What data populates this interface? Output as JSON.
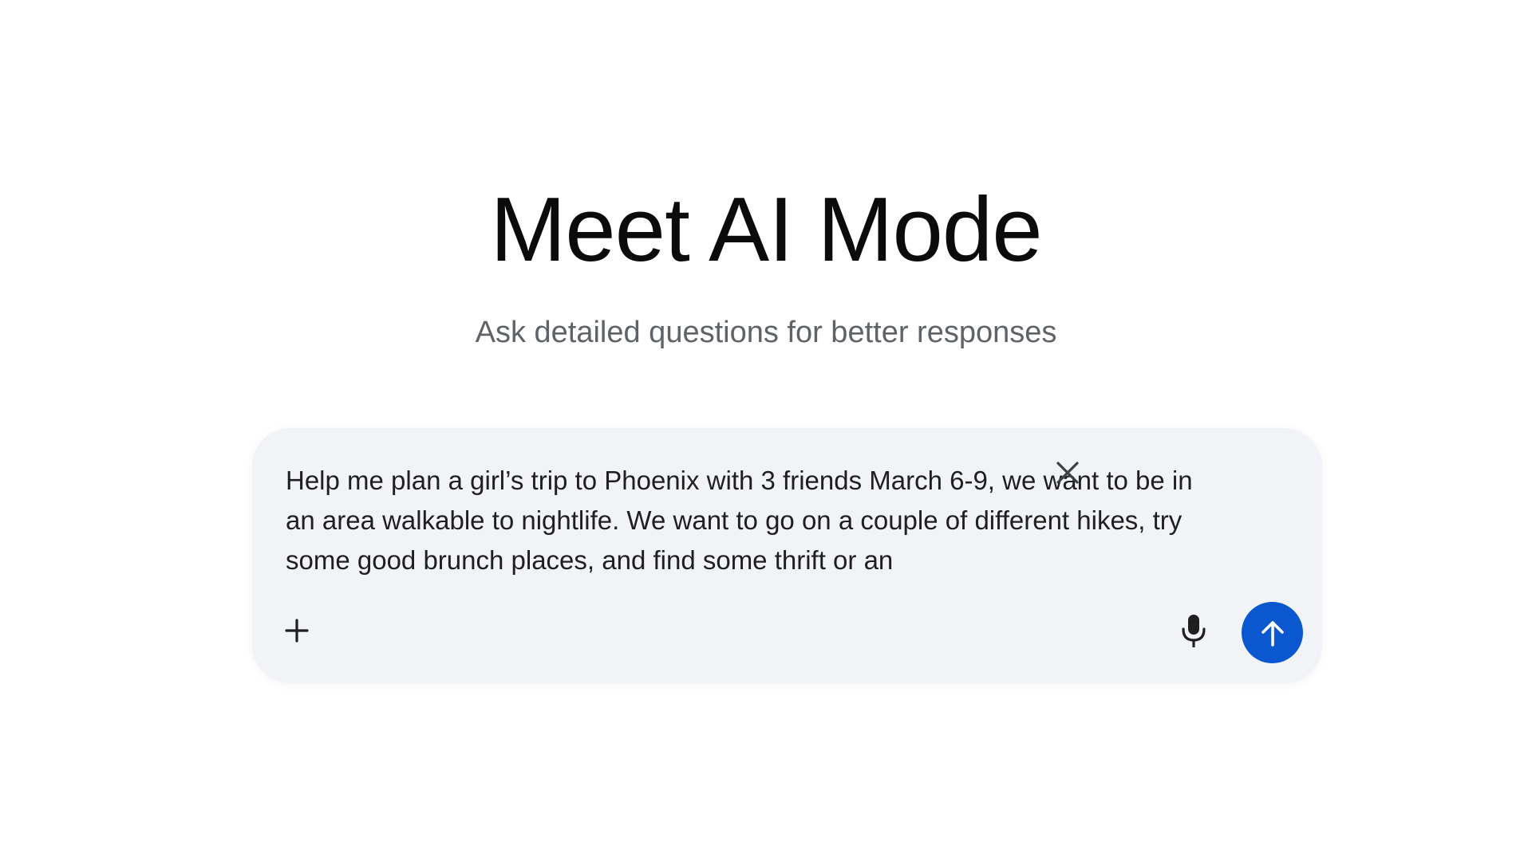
{
  "hero": {
    "title": "Meet AI Mode",
    "subtitle": "Ask detailed questions for better responses"
  },
  "prompt": {
    "value": "Help me plan a girl’s trip to Phoenix with 3 friends March 6-9, we want to be in an area walkable to nightlife. We want to go on a couple of different hikes, try some good brunch places, and find some thrift or an"
  },
  "icons": {
    "clear": "close-icon",
    "add": "plus-icon",
    "mic": "microphone-icon",
    "send": "arrow-up-icon"
  },
  "colors": {
    "send_button": "#0b57d0",
    "input_background": "#f1f3f6",
    "subtitle": "#5f6368"
  }
}
